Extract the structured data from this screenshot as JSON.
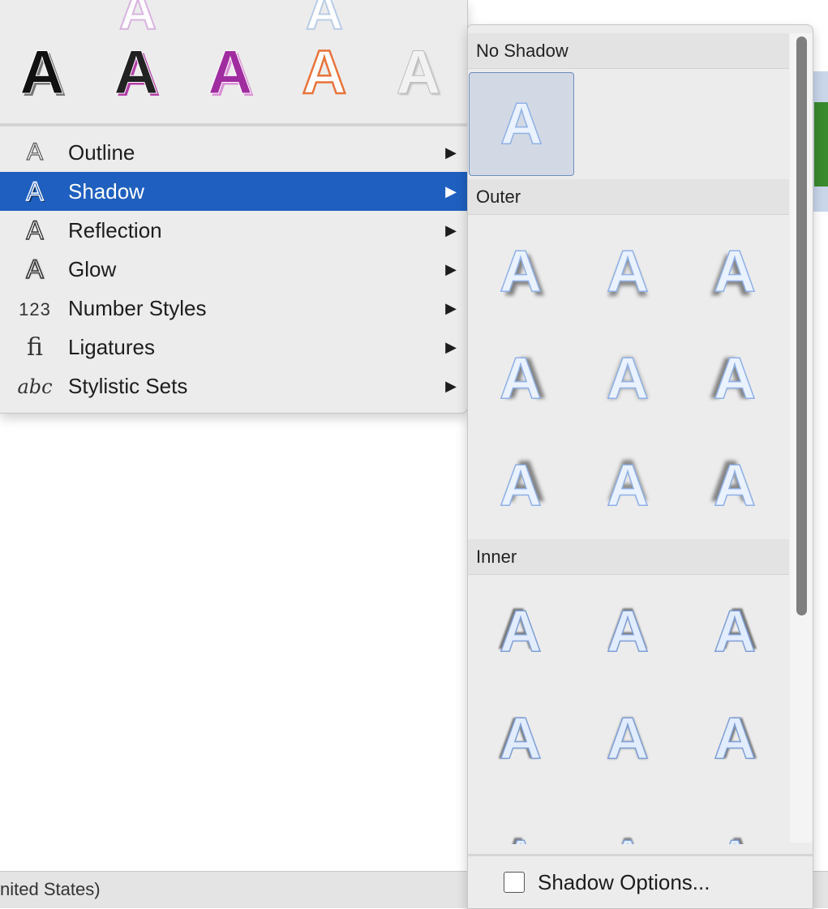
{
  "status_bar": {
    "text": "nited States)"
  },
  "presets": {
    "partial_top": [
      "A",
      "A"
    ],
    "row": [
      "A",
      "A",
      "A",
      "A",
      "A"
    ]
  },
  "menu": {
    "items": [
      {
        "label": "Outline",
        "icon": "outline-a-icon",
        "icon_text": "A"
      },
      {
        "label": "Shadow",
        "icon": "shadow-a-icon",
        "icon_text": "A",
        "selected": true
      },
      {
        "label": "Reflection",
        "icon": "reflection-a-icon",
        "icon_text": "A"
      },
      {
        "label": "Glow",
        "icon": "glow-a-icon",
        "icon_text": "A"
      },
      {
        "label": "Number Styles",
        "icon": "number-styles-icon",
        "icon_text": "123"
      },
      {
        "label": "Ligatures",
        "icon": "ligature-fi-icon",
        "icon_text": "fi"
      },
      {
        "label": "Stylistic Sets",
        "icon": "stylistic-sets-icon",
        "icon_text": "abc"
      }
    ],
    "arrow": "▶",
    "selected_color": "#1f5fbf"
  },
  "submenu": {
    "sections": {
      "no_shadow": "No Shadow",
      "outer": "Outer",
      "inner": "Inner"
    },
    "glyph": "A",
    "footer_label": "Shadow Options..."
  }
}
